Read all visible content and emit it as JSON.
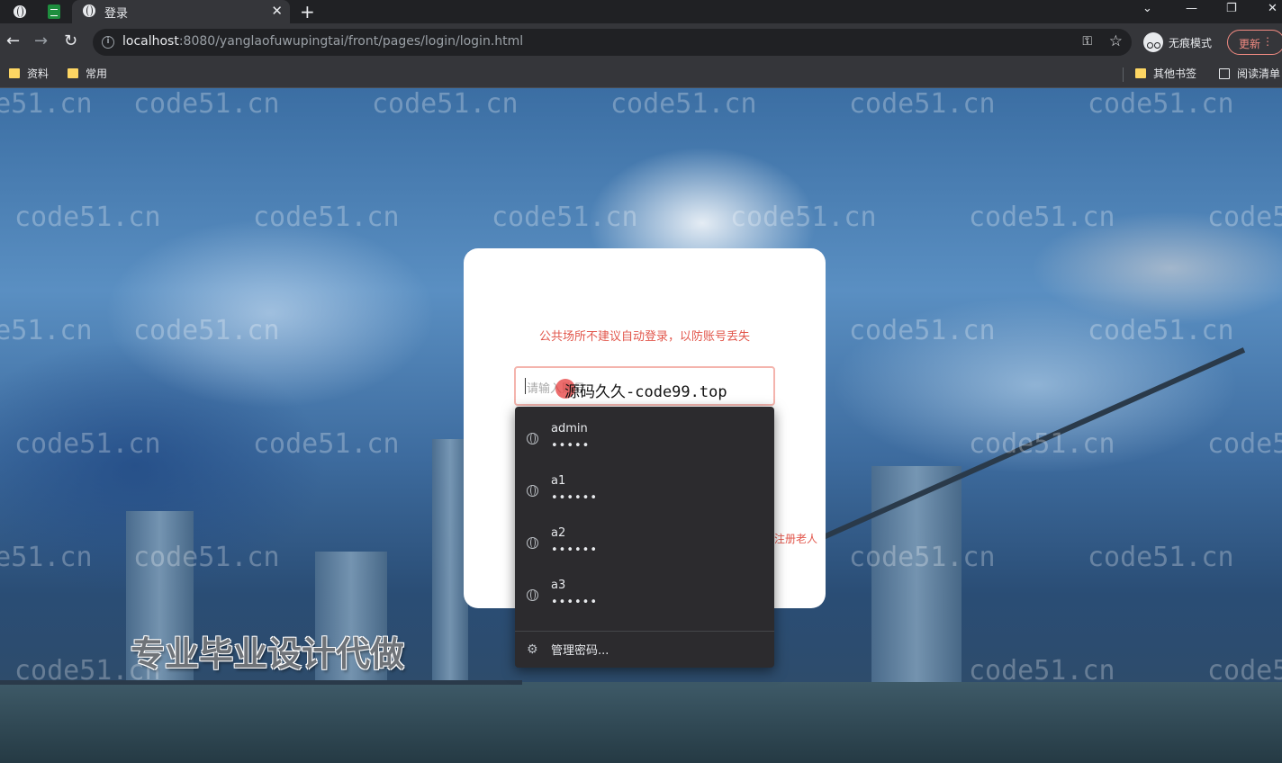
{
  "browser": {
    "tab_title": "登录",
    "url_host": "localhost",
    "url_rest": ":8080/yanglaofuwupingtai/front/pages/login/login.html",
    "incognito_label": "无痕模式",
    "update_label": "更新",
    "bookmarks": [
      "资料",
      "常用"
    ],
    "other_bookmarks": "其他书签",
    "reading_list": "阅读清单"
  },
  "login": {
    "tip": "公共场所不建议自动登录，以防账号丢失",
    "username_placeholder": "请输入账号",
    "register_link": "注册老人"
  },
  "autofill": {
    "entries": [
      {
        "username": "admin",
        "password_mask": "•••••"
      },
      {
        "username": "a1",
        "password_mask": "••••••"
      },
      {
        "username": "a2",
        "password_mask": "••••••"
      },
      {
        "username": "a3",
        "password_mask": "••••••"
      }
    ],
    "manage_label": "管理密码..."
  },
  "overlay": {
    "source_text": "源码久久-code99.top",
    "promo_text": "专业毕业设计代做",
    "watermark_text": "code51.cn"
  },
  "colors": {
    "chrome_dark": "#202124",
    "toolbar": "#35363a",
    "accent_red": "#e2574c",
    "autofill_bg": "#2c2b2e"
  }
}
